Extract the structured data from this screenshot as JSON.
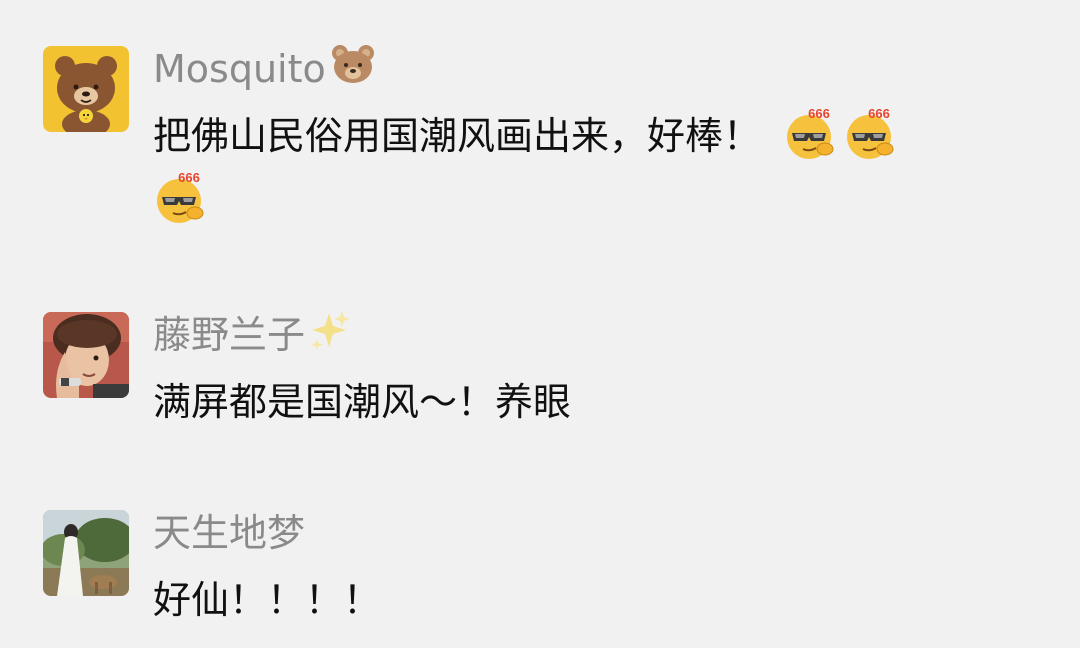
{
  "comments": [
    {
      "author": "Mosquito",
      "author_emoji": "bear-face-icon",
      "avatar": "brown-bear-avatar",
      "text_line1": "把佛山民俗用国潮风画出来，好棒！",
      "reaction_badge": "666",
      "emoji_count": 3
    },
    {
      "author": "藤野兰子",
      "author_emoji": "sparkles-icon",
      "avatar": "person-photo-avatar",
      "text": "满屏都是国潮风～！养眼"
    },
    {
      "author": "天生地梦",
      "avatar": "landscape-photo-avatar",
      "text": "好仙！！！！"
    }
  ],
  "colors": {
    "background": "#f1f1f1",
    "author_name": "#8a8a8a",
    "comment_text": "#111111",
    "emoji_yellow": "#f6c13d",
    "badge_red": "#e8452f"
  }
}
